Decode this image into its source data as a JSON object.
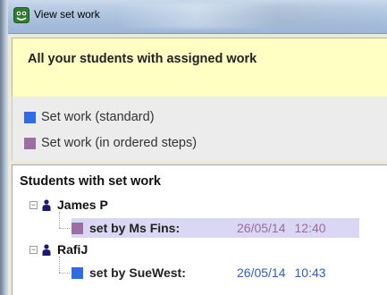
{
  "window": {
    "title": "View set work"
  },
  "header": {
    "text": "All your students with assigned work"
  },
  "legend": [
    {
      "label": "Set work (standard)",
      "color": "#2e6ce4"
    },
    {
      "label": "Set work (in ordered steps)",
      "color": "#9c6ea4"
    }
  ],
  "tree": {
    "title": "Students with set work",
    "students": [
      {
        "name": "James P",
        "work": {
          "set_by": "set by Ms Fins:",
          "date": "26/05/14",
          "time": "12:40",
          "type": "ordered",
          "color": "#9c6ea4",
          "text_color": "#9b6aa3",
          "selected": true
        }
      },
      {
        "name": "RafiJ",
        "work": {
          "set_by": "set by SueWest:",
          "date": "26/05/14",
          "time": "10:43",
          "type": "standard",
          "color": "#2e6ce4",
          "text_color": "#2a5fc8",
          "selected": false
        }
      }
    ]
  }
}
